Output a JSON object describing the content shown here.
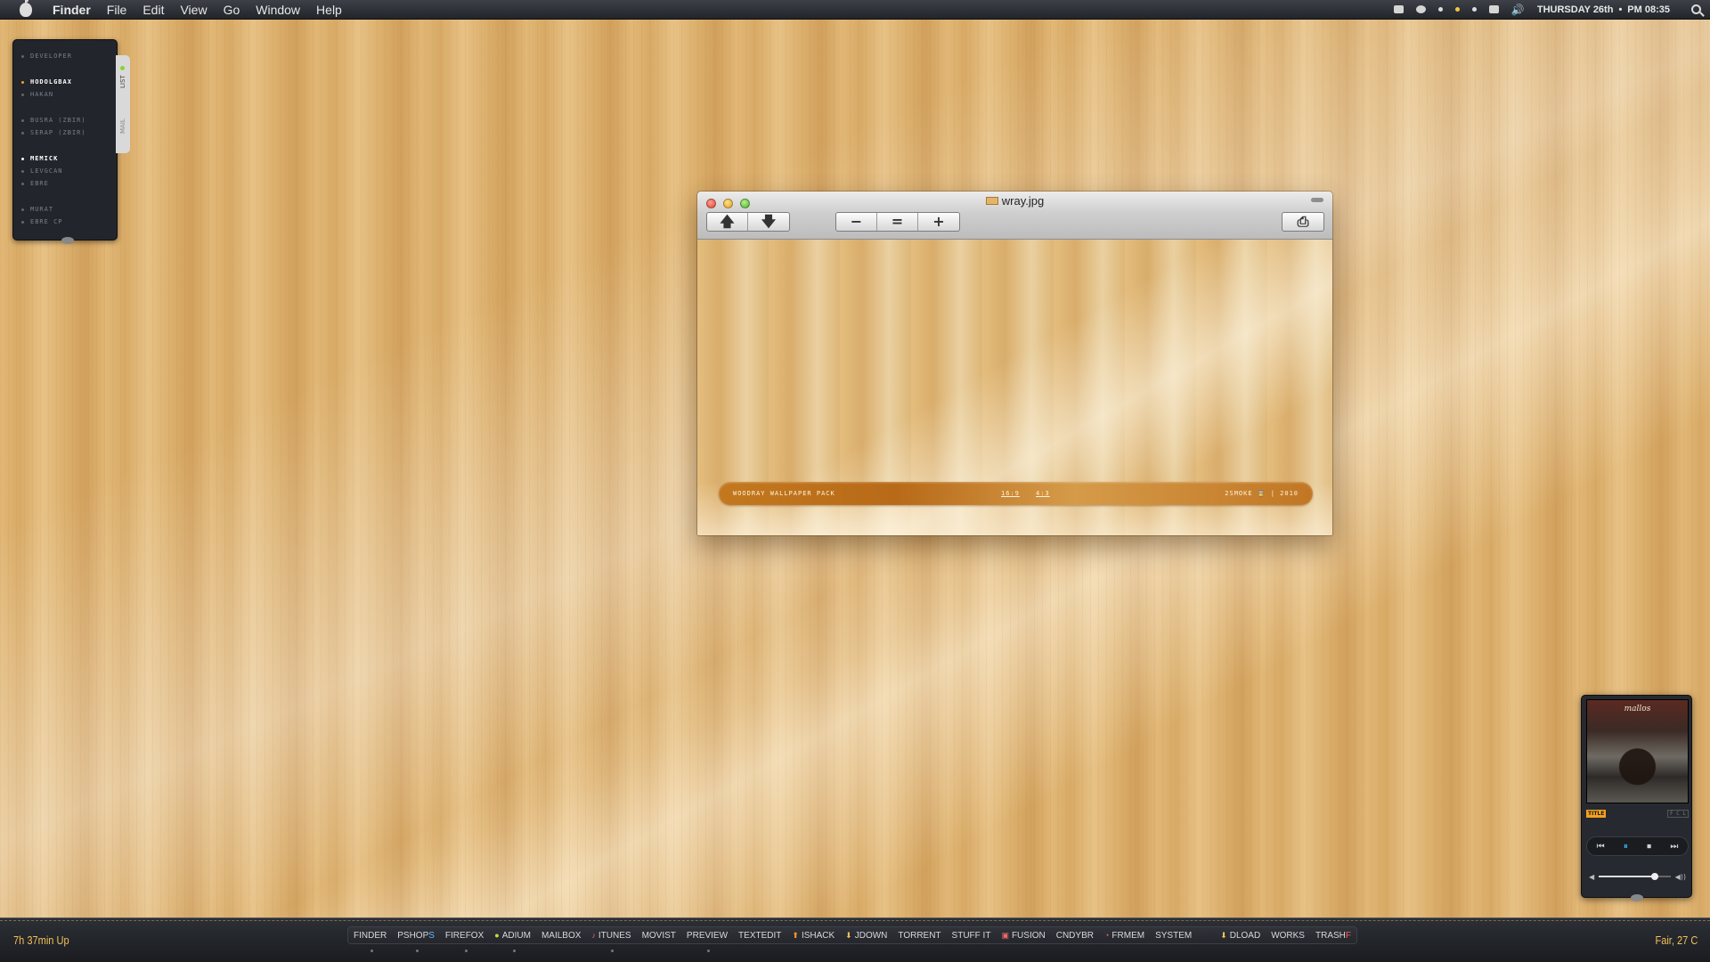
{
  "menubar": {
    "app_name": "Finder",
    "menus": [
      "File",
      "Edit",
      "View",
      "Go",
      "Window",
      "Help"
    ],
    "date": "THURSDAY 26th",
    "separator": "•",
    "time": "PM 08:35"
  },
  "contacts": {
    "items": [
      {
        "name": "DEVELOPER"
      },
      {
        "name": "HODOLGBAX"
      },
      {
        "name": "HAKAN"
      },
      {
        "name": "BUSRA (ZBIR)"
      },
      {
        "name": "SERAP (ZBIR)"
      },
      {
        "name": "MEMICK"
      },
      {
        "name": "LEVGCAN"
      },
      {
        "name": "EBRE"
      },
      {
        "name": "MURAT"
      },
      {
        "name": "EBRE CP"
      }
    ],
    "tab_list": "LIST",
    "tab_mail": "MAIL"
  },
  "window": {
    "title": "wray.jpg",
    "buttons": {
      "prev": "🡅",
      "next": "🡇",
      "zoom_out": "−",
      "actual_size": "=",
      "zoom_in": "+",
      "print": "⎙"
    },
    "banner": {
      "title": "WOODRAY WALLPAPER PACK",
      "ratio1": "16:9",
      "ratio2": "4:3",
      "credit": "2SMOKE ⌛ | 2010"
    }
  },
  "player": {
    "band": "mallos",
    "tag": "TITLE",
    "option": "F C L",
    "controls": {
      "prev": "⏮",
      "play": "⏸",
      "stop": "⏹",
      "next": "⏭"
    },
    "vol_low": "◀",
    "vol_high": "◀))",
    "volume_level": 0.78
  },
  "dock": {
    "uptime": "7h 37min Up",
    "weather": "Fair, 27 C",
    "items": [
      {
        "label": "FINDER",
        "icon": ""
      },
      {
        "label": "PSHOP",
        "suffix": "S",
        "icon": ""
      },
      {
        "label": "FIREFOX",
        "icon": ""
      },
      {
        "label": "ADIUM",
        "icon": "●"
      },
      {
        "label": "MAILBOX",
        "icon": ""
      },
      {
        "label": "ITUNES",
        "icon": "♪"
      },
      {
        "label": "MOVIST",
        "icon": ""
      },
      {
        "label": "PREVIEW",
        "icon": ""
      },
      {
        "label": "TEXTEDIT",
        "icon": ""
      },
      {
        "label": "ISHACK",
        "icon": "⬆"
      },
      {
        "label": "JDOWN",
        "icon": "⬇"
      },
      {
        "label": "TORRENT",
        "icon": ""
      },
      {
        "label": "STUFF IT",
        "icon": ""
      },
      {
        "label": "FUSION",
        "icon": "▣"
      },
      {
        "label": "CNDYBR",
        "icon": ""
      },
      {
        "label": "FRMEM",
        "icon": "◔"
      },
      {
        "label": "SYSTEM",
        "icon": ""
      }
    ],
    "extras": [
      {
        "label": "DLOAD",
        "icon": "⬇"
      },
      {
        "label": "WORKS",
        "icon": ""
      },
      {
        "label": "TRASH",
        "suffix": "F",
        "icon": ""
      }
    ]
  }
}
